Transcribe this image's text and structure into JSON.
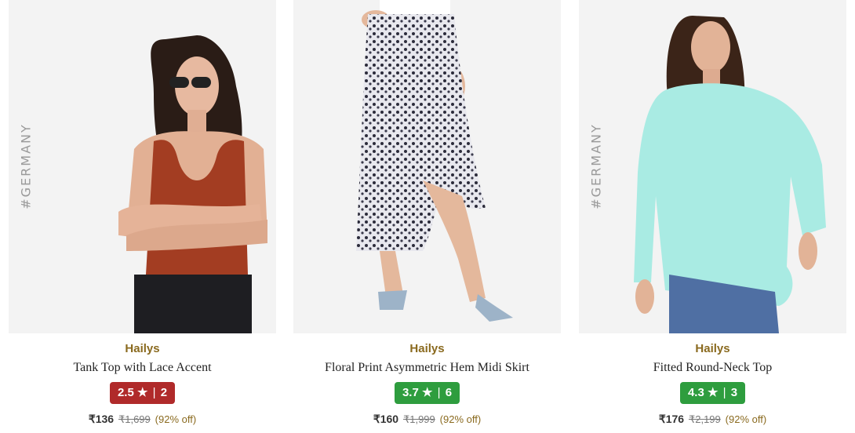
{
  "products": [
    {
      "brand": "Hailys",
      "name": "Tank Top with Lace Accent",
      "rating": "2.5",
      "rating_star": "★",
      "rating_sep": "|",
      "rating_count": "2",
      "rating_color": "#b02a2a",
      "price": "₹136",
      "mrp": "₹1,699",
      "discount": "(92% off)",
      "badge": "#GERMANY",
      "image_icon": "model-tank-top-image"
    },
    {
      "brand": "Hailys",
      "name": "Floral Print Asymmetric Hem Midi Skirt",
      "rating": "3.7",
      "rating_star": "★",
      "rating_sep": "|",
      "rating_count": "6",
      "rating_color": "#2e9d3e",
      "price": "₹160",
      "mrp": "₹1,999",
      "discount": "(92% off)",
      "badge": "",
      "image_icon": "model-midi-skirt-image"
    },
    {
      "brand": "Hailys",
      "name": "Fitted Round-Neck Top",
      "rating": "4.3",
      "rating_star": "★",
      "rating_sep": "|",
      "rating_count": "3",
      "rating_color": "#2e9d3e",
      "price": "₹176",
      "mrp": "₹2,199",
      "discount": "(92% off)",
      "badge": "#GERMANY",
      "image_icon": "model-round-neck-top-image"
    }
  ]
}
